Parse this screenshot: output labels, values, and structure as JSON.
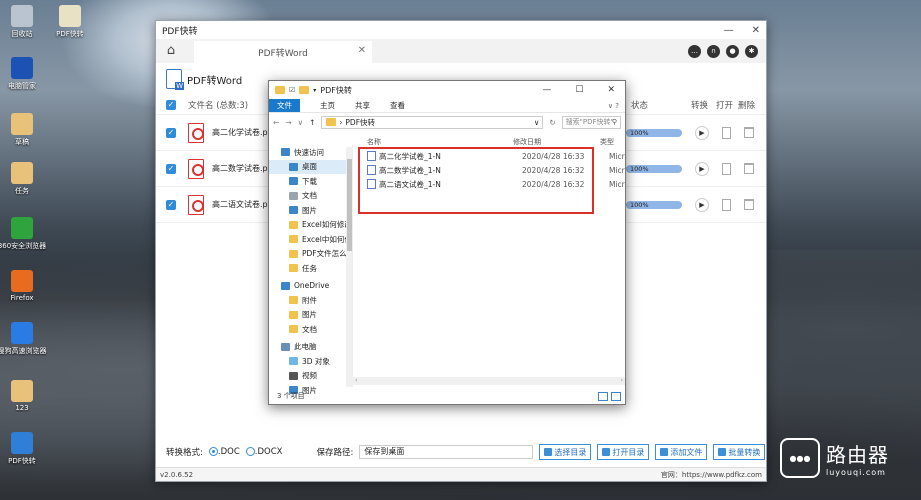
{
  "desktop": {
    "icons": [
      {
        "label": "回收站",
        "color": "#b9c4cf"
      },
      {
        "label": "PDF快转",
        "color": "#e9e1c4"
      },
      {
        "label": "电脑管家",
        "color": "#1d52b5"
      },
      {
        "label": "草稿",
        "color": "#e8c27a"
      },
      {
        "label": "任务",
        "color": "#e8c27a"
      },
      {
        "label": "360安全浏览器",
        "color": "#2fa33c"
      },
      {
        "label": "Firefox",
        "color": "#e86b1f"
      },
      {
        "label": "搜狗高速浏览器",
        "color": "#2a7be4"
      },
      {
        "label": "123",
        "color": "#e8c27a"
      },
      {
        "label": "PDF快转",
        "color": "#2f7ed8"
      }
    ]
  },
  "app": {
    "title": "PDF快转",
    "tab_label": "PDF转Word",
    "page_heading": "PDF转Word",
    "table": {
      "col_name": "文件名 (总数:3)",
      "col_status": "状态",
      "col_convert": "转换",
      "col_open": "打开",
      "col_delete": "删除"
    },
    "rows": [
      {
        "name": "高二化学试卷.pdf",
        "progress": "100%"
      },
      {
        "name": "高二数学试卷.pdf",
        "progress": "100%"
      },
      {
        "name": "高二语文试卷.pdf",
        "progress": "100%"
      }
    ],
    "bottom": {
      "format_label": "转换格式:",
      "doc_option": ".DOC",
      "docx_option": ".DOCX",
      "save_path_label": "保存路径:",
      "save_path_value": "保存到桌面",
      "btn_select_dir": "选择目录",
      "btn_open_dir": "打开目录",
      "btn_add_file": "添加文件",
      "btn_batch_convert": "批量转换"
    },
    "status": {
      "version": "v2.0.6.52",
      "website": "官网：https://www.pdfkz.com"
    }
  },
  "explorer": {
    "title": "PDF快转",
    "ribbon": [
      "文件",
      "主页",
      "共享",
      "查看"
    ],
    "path": "PDF快转",
    "search_placeholder": "搜索\"PDF快转\"",
    "nav": [
      {
        "label": "快速访问",
        "level": 1,
        "color": "#3b86c9"
      },
      {
        "label": "桌面",
        "level": 2,
        "color": "#3b86c9",
        "highlight": true
      },
      {
        "label": "下载",
        "level": 2,
        "color": "#3b86c9"
      },
      {
        "label": "文档",
        "level": 2,
        "color": "#9aa4ad"
      },
      {
        "label": "图片",
        "level": 2,
        "color": "#3b86c9"
      },
      {
        "label": "Excel如何修改",
        "level": 2,
        "color": "#f2c24e"
      },
      {
        "label": "Excel中如何使",
        "level": 2,
        "color": "#f2c24e"
      },
      {
        "label": "PDF文件怎么",
        "level": 2,
        "color": "#f2c24e"
      },
      {
        "label": "任务",
        "level": 2,
        "color": "#f2c24e"
      },
      {
        "label": "OneDrive",
        "level": 1,
        "color": "#3b86c9"
      },
      {
        "label": "附件",
        "level": 2,
        "color": "#f2c24e"
      },
      {
        "label": "图片",
        "level": 2,
        "color": "#f2c24e"
      },
      {
        "label": "文档",
        "level": 2,
        "color": "#f2c24e"
      },
      {
        "label": "此电脑",
        "level": 1,
        "color": "#6c8fb8"
      },
      {
        "label": "3D 对象",
        "level": 2,
        "color": "#6fb6e3"
      },
      {
        "label": "视频",
        "level": 2,
        "color": "#555555"
      },
      {
        "label": "图片",
        "level": 2,
        "color": "#3b86c9"
      }
    ],
    "columns": {
      "name": "名称",
      "date": "修改日期",
      "type": "类型"
    },
    "files": [
      {
        "name": "高二化学试卷_1-N",
        "date": "2020/4/28 16:33",
        "type": "Micr"
      },
      {
        "name": "高二数学试卷_1-N",
        "date": "2020/4/28 16:32",
        "type": "Micr"
      },
      {
        "name": "高二语文试卷_1-N",
        "date": "2020/4/28 16:32",
        "type": "Micr"
      }
    ],
    "status_text": "3 个项目"
  },
  "watermark": {
    "title": "路由器",
    "subtitle": "luyouqi.com"
  }
}
